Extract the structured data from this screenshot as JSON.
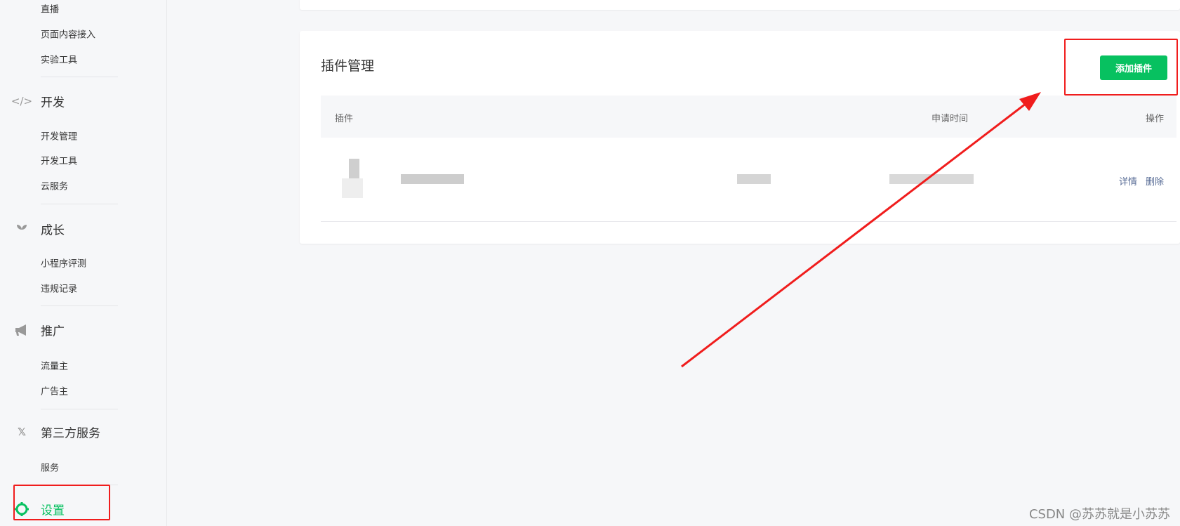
{
  "sidebar": {
    "items": [
      {
        "label": "直播"
      },
      {
        "label": "页面内容接入"
      },
      {
        "label": "实验工具"
      }
    ],
    "groups": [
      {
        "label": "开发",
        "icon": "code-icon",
        "items": [
          "开发管理",
          "开发工具",
          "云服务"
        ]
      },
      {
        "label": "成长",
        "icon": "sprout-icon",
        "items": [
          "小程序评测",
          "违规记录"
        ]
      },
      {
        "label": "推广",
        "icon": "megaphone-icon",
        "items": [
          "流量主",
          "广告主"
        ]
      },
      {
        "label": "第三方服务",
        "icon": "third-party-icon",
        "items": [
          "服务"
        ]
      },
      {
        "label": "设置",
        "icon": "gear-icon",
        "active": true,
        "items": []
      }
    ]
  },
  "plugin": {
    "title": "插件管理",
    "add_button": "添加插件",
    "columns": [
      "插件",
      "申请时间",
      "操作"
    ],
    "row_actions": [
      "详情",
      "删除"
    ]
  },
  "colors": {
    "accent": "#07c160",
    "annotation": "#f01d1d",
    "link": "#576b95"
  },
  "watermark": "CSDN @苏苏就是小苏苏"
}
